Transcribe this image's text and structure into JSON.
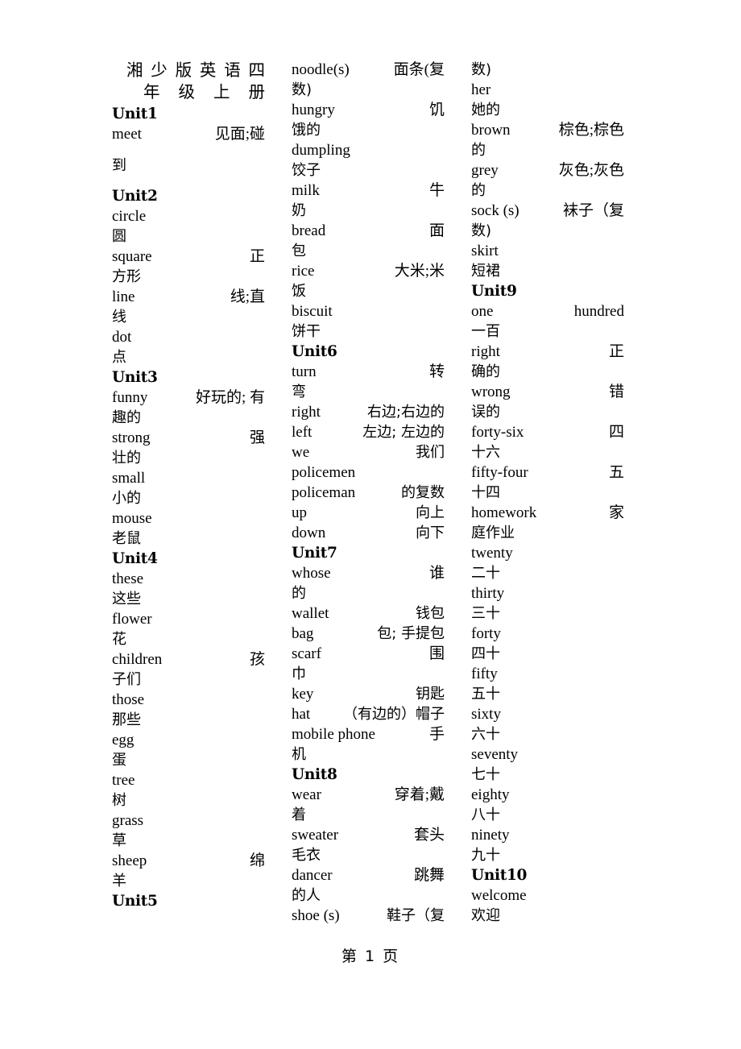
{
  "document": {
    "title_line1": "湘少版英语四",
    "title_line2": "年级上册",
    "title_full": "湘少版英语四年级上册",
    "footer": "第 1 页"
  },
  "columns": [
    {
      "id": "column-1",
      "blocks": [
        {
          "type": "unit",
          "label": "Unit1"
        },
        {
          "type": "entry",
          "en": "meet",
          "zh1": "见面;碰",
          "zh2": "到"
        },
        {
          "type": "unit",
          "label": "Unit2"
        },
        {
          "type": "entry",
          "en": "circle",
          "zh1": "",
          "zh2": "圆"
        },
        {
          "type": "entry",
          "en": "square",
          "zh1": "正",
          "zh2": "方形"
        },
        {
          "type": "entry",
          "en": "line",
          "zh1": "线;直",
          "zh2": "线"
        },
        {
          "type": "entry",
          "en": "dot",
          "zh1": "",
          "zh2": "点"
        },
        {
          "type": "unit",
          "label": "Unit3"
        },
        {
          "type": "entry",
          "en": "funny",
          "zh1": "好玩的; 有",
          "zh2": "趣的"
        },
        {
          "type": "entry",
          "en": "strong",
          "zh1": "强",
          "zh2": "壮的"
        },
        {
          "type": "entry",
          "en": "small",
          "zh1": "",
          "zh2": "小的"
        },
        {
          "type": "entry",
          "en": "mouse",
          "zh1": "",
          "zh2": "老鼠"
        },
        {
          "type": "unit",
          "label": "Unit4"
        },
        {
          "type": "entry",
          "en": "these",
          "zh1": "",
          "zh2": "这些"
        },
        {
          "type": "entry",
          "en": "flower",
          "zh1": "",
          "zh2": "花"
        },
        {
          "type": "entry",
          "en": "children",
          "zh1": "孩",
          "zh2": "子们"
        },
        {
          "type": "entry",
          "en": "those",
          "zh1": "",
          "zh2": "那些"
        },
        {
          "type": "entry",
          "en": "egg",
          "zh1": "",
          "zh2": "蛋"
        },
        {
          "type": "entry",
          "en": "tree",
          "zh1": "",
          "zh2": "树"
        },
        {
          "type": "entry",
          "en": "grass",
          "zh1": "",
          "zh2": "草"
        },
        {
          "type": "entry",
          "en": "sheep",
          "zh1": "绵",
          "zh2": "羊"
        },
        {
          "type": "unit",
          "label": "Unit5"
        }
      ]
    },
    {
      "id": "column-2",
      "blocks": [
        {
          "type": "entry",
          "en": "noodle(s)",
          "zh1": "面条(复",
          "zh2": "数)"
        },
        {
          "type": "entry",
          "en": "hungry",
          "zh1": "饥",
          "zh2": "饿的"
        },
        {
          "type": "entry",
          "en": "dumpling",
          "zh1": "",
          "zh2": "饺子"
        },
        {
          "type": "entry",
          "en": "milk",
          "zh1": "牛",
          "zh2": "奶"
        },
        {
          "type": "entry",
          "en": "bread",
          "zh1": "面",
          "zh2": "包"
        },
        {
          "type": "entry",
          "en": "rice",
          "zh1": "大米;米",
          "zh2": "饭"
        },
        {
          "type": "entry",
          "en": "biscuit",
          "zh1": "",
          "zh2": "饼干"
        },
        {
          "type": "unit",
          "label": "Unit6"
        },
        {
          "type": "entry",
          "en": "turn",
          "zh1": "转",
          "zh2": "弯"
        },
        {
          "type": "entry",
          "en": "right",
          "zh1": "右边;右边的",
          "zh2": ""
        },
        {
          "type": "entry",
          "en": "left",
          "zh1": "左边; 左边的",
          "zh2": ""
        },
        {
          "type": "entry",
          "en": "we",
          "zh1": "我们",
          "zh2": ""
        },
        {
          "type": "entry",
          "en": "policemen",
          "zh1": "",
          "zh2": ""
        },
        {
          "type": "entry",
          "en": "policeman",
          "zh1": "的复数",
          "zh2": ""
        },
        {
          "type": "entry",
          "en": "up",
          "zh1": "向上",
          "zh2": ""
        },
        {
          "type": "entry",
          "en": "down",
          "zh1": "向下",
          "zh2": ""
        },
        {
          "type": "unit",
          "label": "Unit7"
        },
        {
          "type": "entry",
          "en": "whose",
          "zh1": "谁",
          "zh2": "的"
        },
        {
          "type": "entry",
          "en": "wallet",
          "zh1": "钱包",
          "zh2": ""
        },
        {
          "type": "entry",
          "en": "bag",
          "zh1": "包; 手提包",
          "zh2": ""
        },
        {
          "type": "entry",
          "en": "scarf",
          "zh1": "围",
          "zh2": "巾"
        },
        {
          "type": "entry",
          "en": "key",
          "zh1": "钥匙",
          "zh2": ""
        },
        {
          "type": "entry",
          "en": "hat",
          "zh1": "（有边的）帽子",
          "zh2": ""
        },
        {
          "type": "entry",
          "en": "mobile phone",
          "zh1": "手",
          "zh2": "机"
        },
        {
          "type": "unit",
          "label": "Unit8"
        },
        {
          "type": "entry",
          "en": "wear",
          "zh1": "穿着;戴",
          "zh2": "着"
        },
        {
          "type": "entry",
          "en": "sweater",
          "zh1": "套头",
          "zh2": "毛衣"
        },
        {
          "type": "entry",
          "en": "dancer",
          "zh1": "跳舞",
          "zh2": "的人"
        },
        {
          "type": "entry",
          "en": "shoe (s)",
          "zh1": "鞋子（复",
          "zh2": ""
        }
      ]
    },
    {
      "id": "column-3",
      "blocks": [
        {
          "type": "zh",
          "text": "数)"
        },
        {
          "type": "entry",
          "en": "her",
          "zh1": "",
          "zh2": "她的"
        },
        {
          "type": "entry",
          "en": "brown",
          "zh1": "棕色;棕色",
          "zh2": "的"
        },
        {
          "type": "entry",
          "en": "grey",
          "zh1": "灰色;灰色",
          "zh2": "的"
        },
        {
          "type": "entry",
          "en": "sock (s)",
          "zh1": "袜子（复",
          "zh2": "数)"
        },
        {
          "type": "entry",
          "en": "skirt",
          "zh1": "",
          "zh2": "短裙"
        },
        {
          "type": "unit",
          "label": "Unit9"
        },
        {
          "type": "entry",
          "en": "one hundred",
          "zh1": "",
          "zh2": "一百"
        },
        {
          "type": "entry",
          "en": "right",
          "zh1": "正",
          "zh2": "确的"
        },
        {
          "type": "entry",
          "en": "wrong",
          "zh1": "错",
          "zh2": "误的"
        },
        {
          "type": "entry",
          "en": "forty-six",
          "zh1": "四",
          "zh2": "十六"
        },
        {
          "type": "entry",
          "en": "fifty-four",
          "zh1": "五",
          "zh2": "十四"
        },
        {
          "type": "entry",
          "en": "homework",
          "zh1": "家",
          "zh2": "庭作业"
        },
        {
          "type": "entry",
          "en": "twenty",
          "zh1": "",
          "zh2": "二十"
        },
        {
          "type": "entry",
          "en": "thirty",
          "zh1": "",
          "zh2": "三十"
        },
        {
          "type": "entry",
          "en": "forty",
          "zh1": "",
          "zh2": "四十"
        },
        {
          "type": "entry",
          "en": "fifty",
          "zh1": "",
          "zh2": "五十"
        },
        {
          "type": "entry",
          "en": "sixty",
          "zh1": "",
          "zh2": "六十"
        },
        {
          "type": "entry",
          "en": "seventy",
          "zh1": "",
          "zh2": "七十"
        },
        {
          "type": "entry",
          "en": "eighty",
          "zh1": "",
          "zh2": "八十"
        },
        {
          "type": "entry",
          "en": "ninety",
          "zh1": "",
          "zh2": "九十"
        },
        {
          "type": "unit",
          "label": "Unit10"
        },
        {
          "type": "entry",
          "en": "welcome",
          "zh1": "",
          "zh2": "欢迎"
        }
      ]
    }
  ]
}
